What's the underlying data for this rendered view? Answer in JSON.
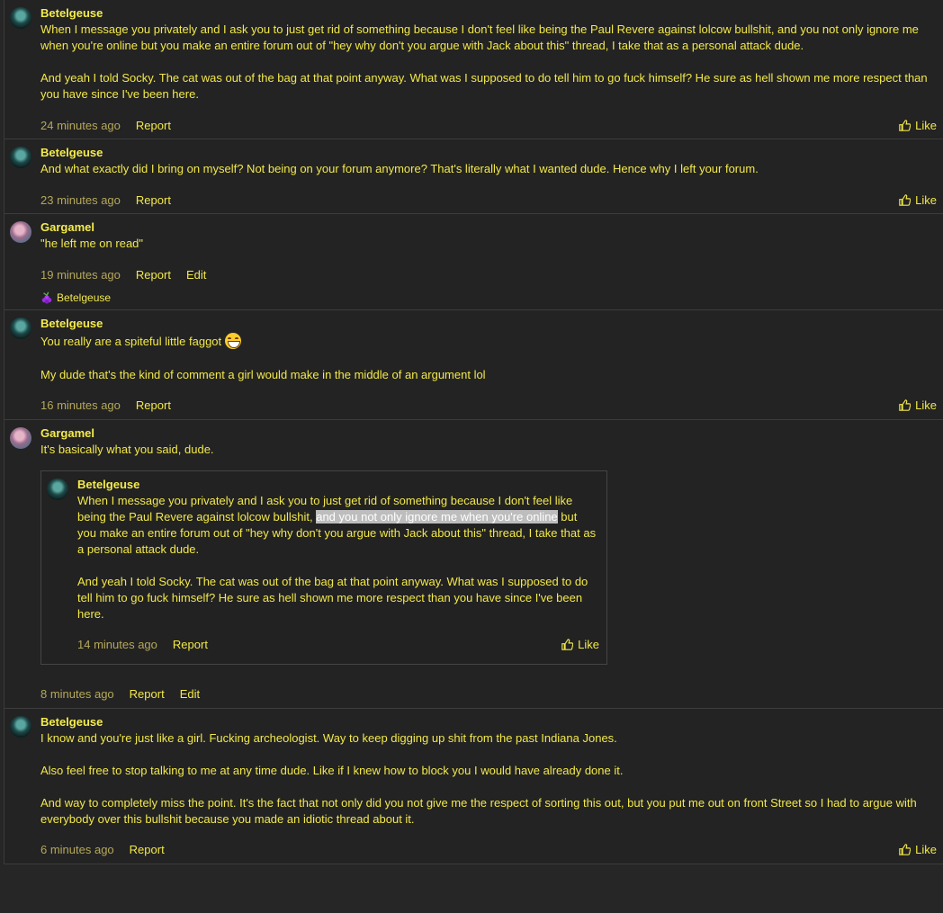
{
  "posts": [
    {
      "author": "Betelgeuse",
      "paragraphs": [
        "When I message you privately and I ask you to just get rid of something because I don't feel like being the Paul Revere against lolcow bullshit, and you not only ignore me when you're online but you make an entire forum out of \"hey why don't you argue with Jack about this\" thread, I take that as a personal attack dude.",
        "And yeah I told Socky. The cat was out of the bag at that point anyway. What was I supposed to do tell him to go fuck himself? He sure as hell shown me more respect than you have since I've been here."
      ],
      "time": "24 minutes ago",
      "report": "Report",
      "like": "Like"
    },
    {
      "author": "Betelgeuse",
      "paragraphs": [
        "And what exactly did I bring on myself? Not being on your forum anymore? That's literally what I wanted dude. Hence why I left your forum."
      ],
      "time": "23 minutes ago",
      "report": "Report",
      "like": "Like"
    },
    {
      "author": "Gargamel",
      "paragraphs": [
        "\"he left me on read\""
      ],
      "time": "19 minutes ago",
      "report": "Report",
      "edit": "Edit",
      "reaction_user": "Betelgeuse"
    },
    {
      "author": "Betelgeuse",
      "paragraph1": "You really are a spiteful little faggot",
      "paragraph2": "My dude that's the kind of comment a girl would make in the middle of an argument lol",
      "time": "16 minutes ago",
      "report": "Report",
      "like": "Like"
    },
    {
      "author": "Gargamel",
      "paragraphs": [
        "It's basically what you said, dude."
      ],
      "quote": {
        "author": "Betelgeuse",
        "p1_before": "When I message you privately and I ask you to just get rid of something because I don't feel like being the Paul Revere against lolcow bullshit, ",
        "p1_highlight": "and you not only ignore me when you're online",
        "p1_after": " but you make an entire forum out of \"hey why don't you argue with Jack about this\" thread, I take that as a personal attack dude.",
        "p2": "And yeah I told Socky. The cat was out of the bag at that point anyway. What was I supposed to do tell him to go fuck himself? He sure as hell shown me more respect than you have since I've been here.",
        "time": "14 minutes ago",
        "report": "Report",
        "like": "Like"
      },
      "time": "8 minutes ago",
      "report": "Report",
      "edit": "Edit"
    },
    {
      "author": "Betelgeuse",
      "paragraphs": [
        "I know and you're just like a girl. Fucking archeologist. Way to keep digging up shit from the past Indiana Jones.",
        "Also feel free to stop talking to me at any time dude. Like if I knew how to block you I would have already done it.",
        "And way to completely miss the point. It's the fact that not only did you not give me the respect of sorting this out, but you put me out on front Street so I had to argue with everybody over this bullshit because you made an idiotic thread about it."
      ],
      "time": "6 minutes ago",
      "report": "Report",
      "like": "Like"
    }
  ],
  "colors": {
    "background": "#262626",
    "text": "#f2e84a",
    "timestamp": "#b5a85a",
    "border": "#3c3c3c"
  },
  "icons": {
    "like": "thumbs-up-icon",
    "reaction": "grape-icon",
    "emoji": "grinning-face-emoji"
  }
}
